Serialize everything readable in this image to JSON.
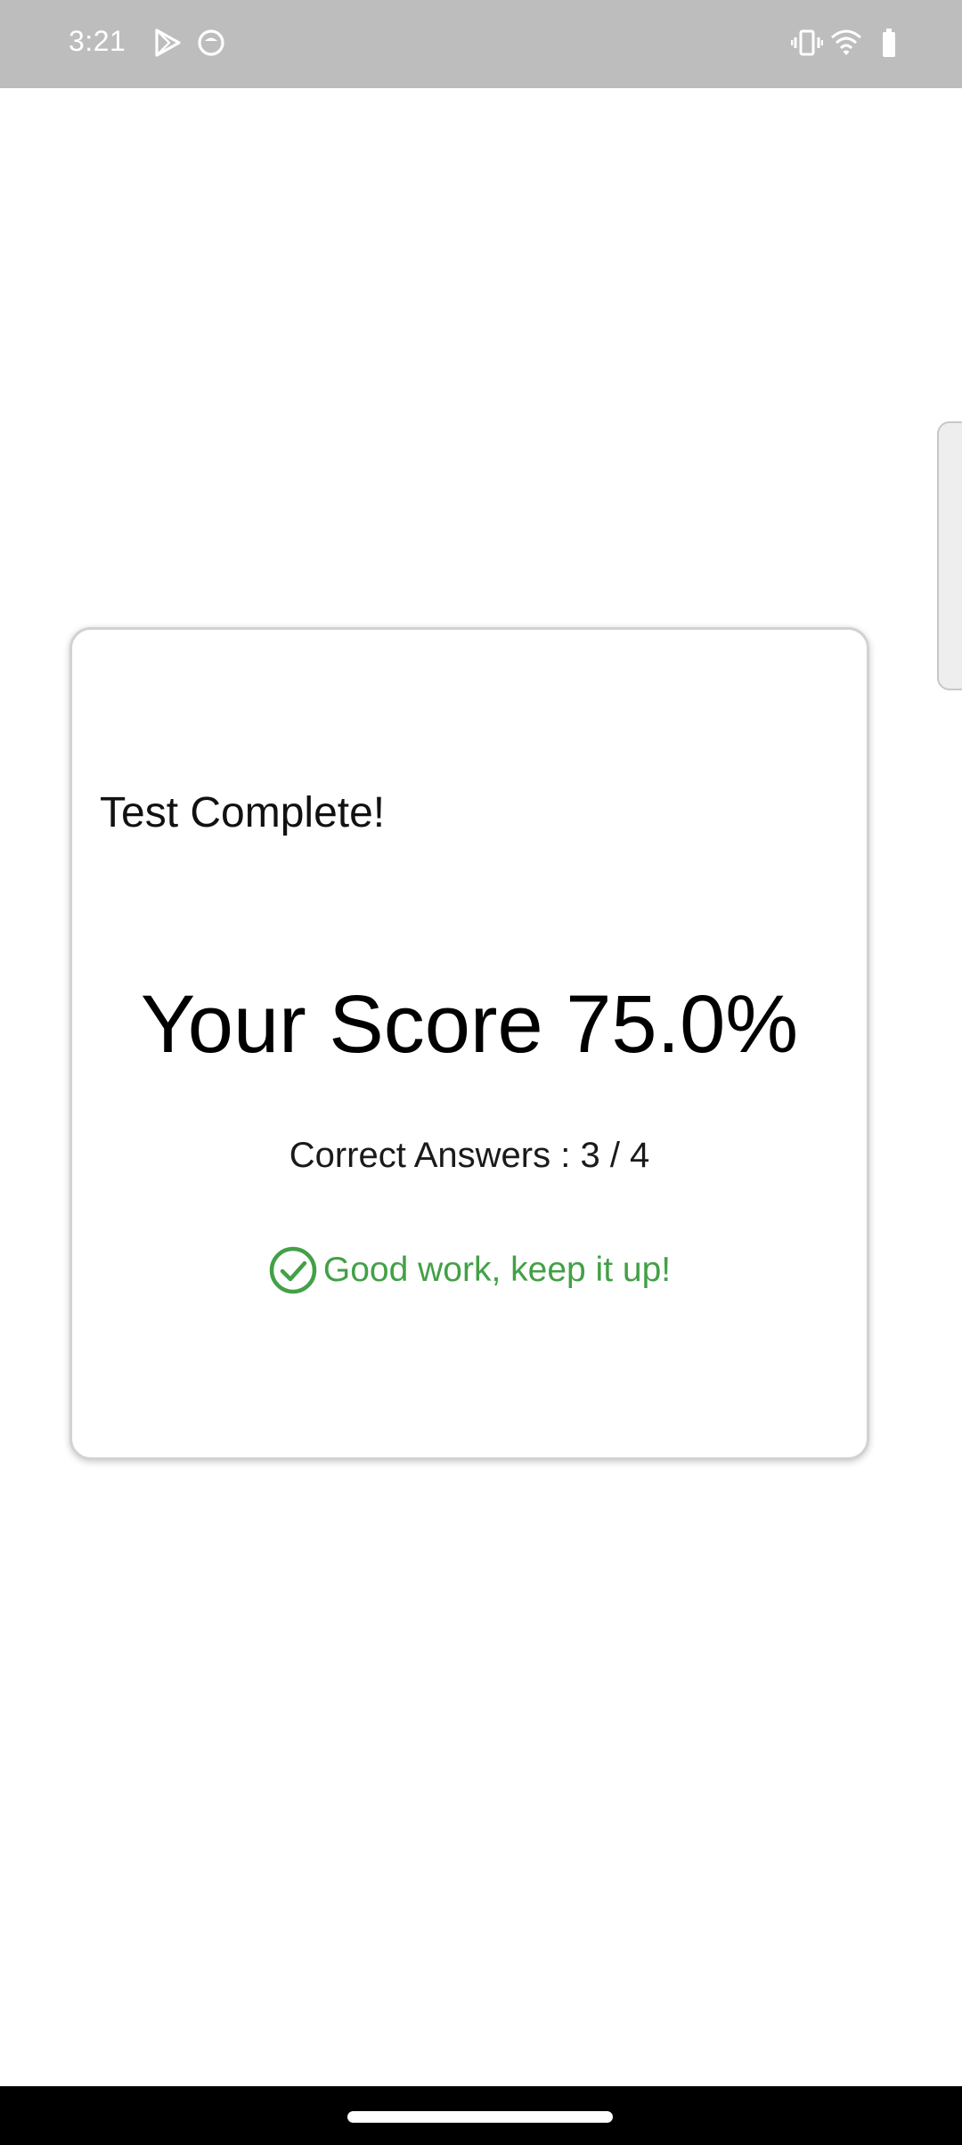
{
  "status_bar": {
    "time": "3:21",
    "icons": [
      "play-store-icon",
      "notification-app-icon",
      "vibrate-icon",
      "wifi-icon",
      "battery-icon"
    ]
  },
  "result_card": {
    "title": "Test Complete!",
    "score_text": "Your Score 75.0%",
    "correct_answers_text": "Correct Answers : 3 / 4",
    "feedback_text": "Good work, keep it up!",
    "feedback_icon": "check-circle-icon"
  },
  "colors": {
    "status_bar_bg": "#bdbdbd",
    "feedback_green": "#43a047",
    "card_border": "#d2d2d2",
    "nav_bar_bg": "#000000"
  }
}
